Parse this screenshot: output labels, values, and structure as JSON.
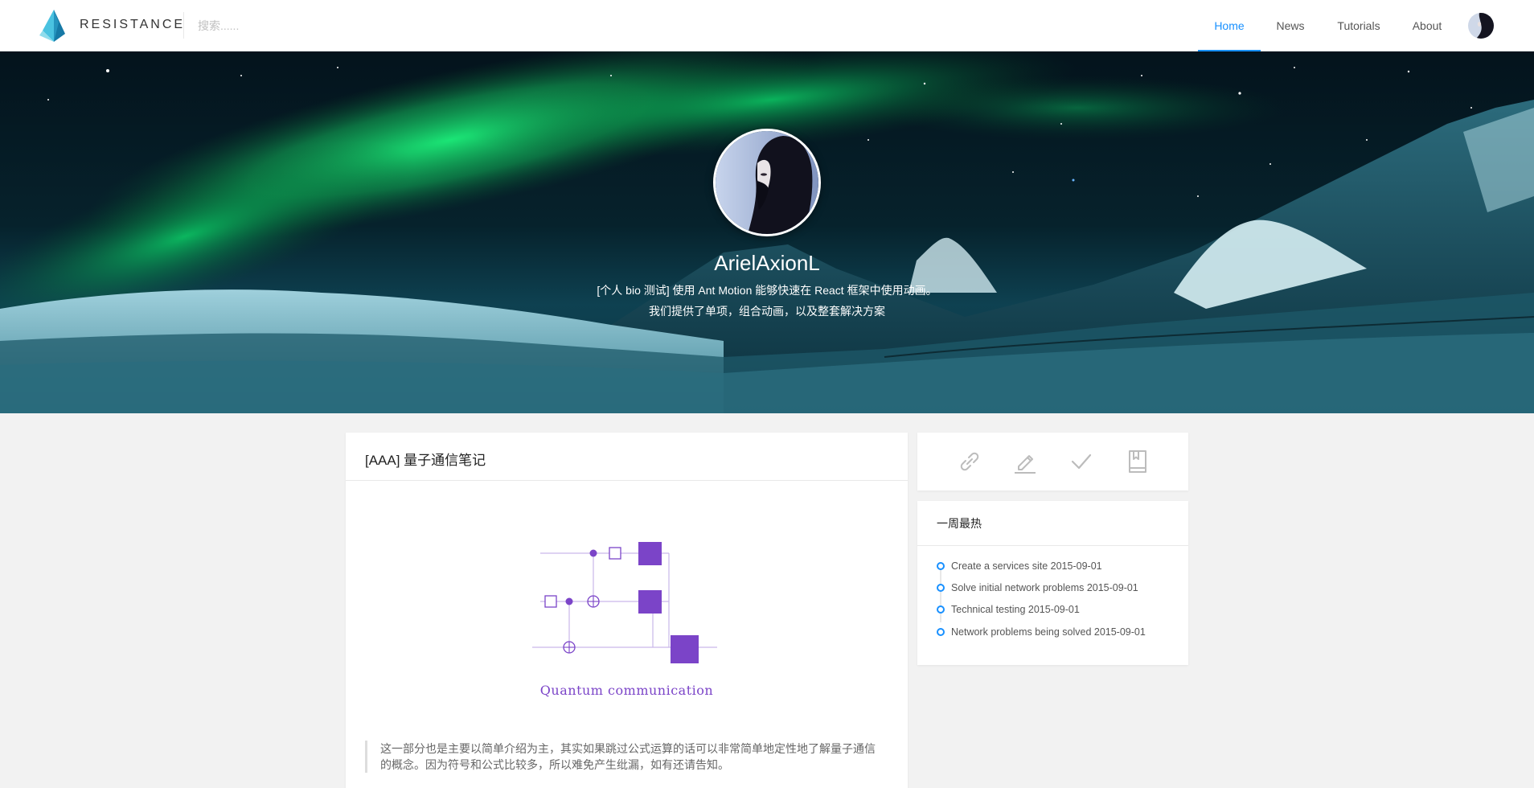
{
  "header": {
    "brand": "RESISTANCE",
    "search_placeholder": "搜索......",
    "nav": [
      {
        "label": "Home",
        "active": true
      },
      {
        "label": "News",
        "active": false
      },
      {
        "label": "Tutorials",
        "active": false
      },
      {
        "label": "About",
        "active": false
      }
    ],
    "accent_color": "#1890ff"
  },
  "profile": {
    "name": "ArielAxionL",
    "bio_line1": "[个人 bio 测试] 使用 Ant Motion 能够快速在 React 框架中使用动画。",
    "bio_line2": "我们提供了单项，组合动画，以及整套解决方案"
  },
  "post": {
    "title": "[AAA] 量子通信笔记",
    "figure_caption": "Quantum communication",
    "quote": "这一部分也是主要以简单介绍为主，其实如果跳过公式运算的话可以非常简单地定性地了解量子通信的概念。因为符号和公式比较多，所以难免产生纰漏，如有还请告知。",
    "figure_color": "#7b44c8"
  },
  "tools": [
    "link-icon",
    "pencil-icon",
    "check-icon",
    "bookmark-icon"
  ],
  "weekly_hot": {
    "title": "一周最热",
    "items": [
      "Create a services site 2015-09-01",
      "Solve initial network problems 2015-09-01",
      "Technical testing 2015-09-01",
      "Network problems being solved 2015-09-01"
    ]
  }
}
